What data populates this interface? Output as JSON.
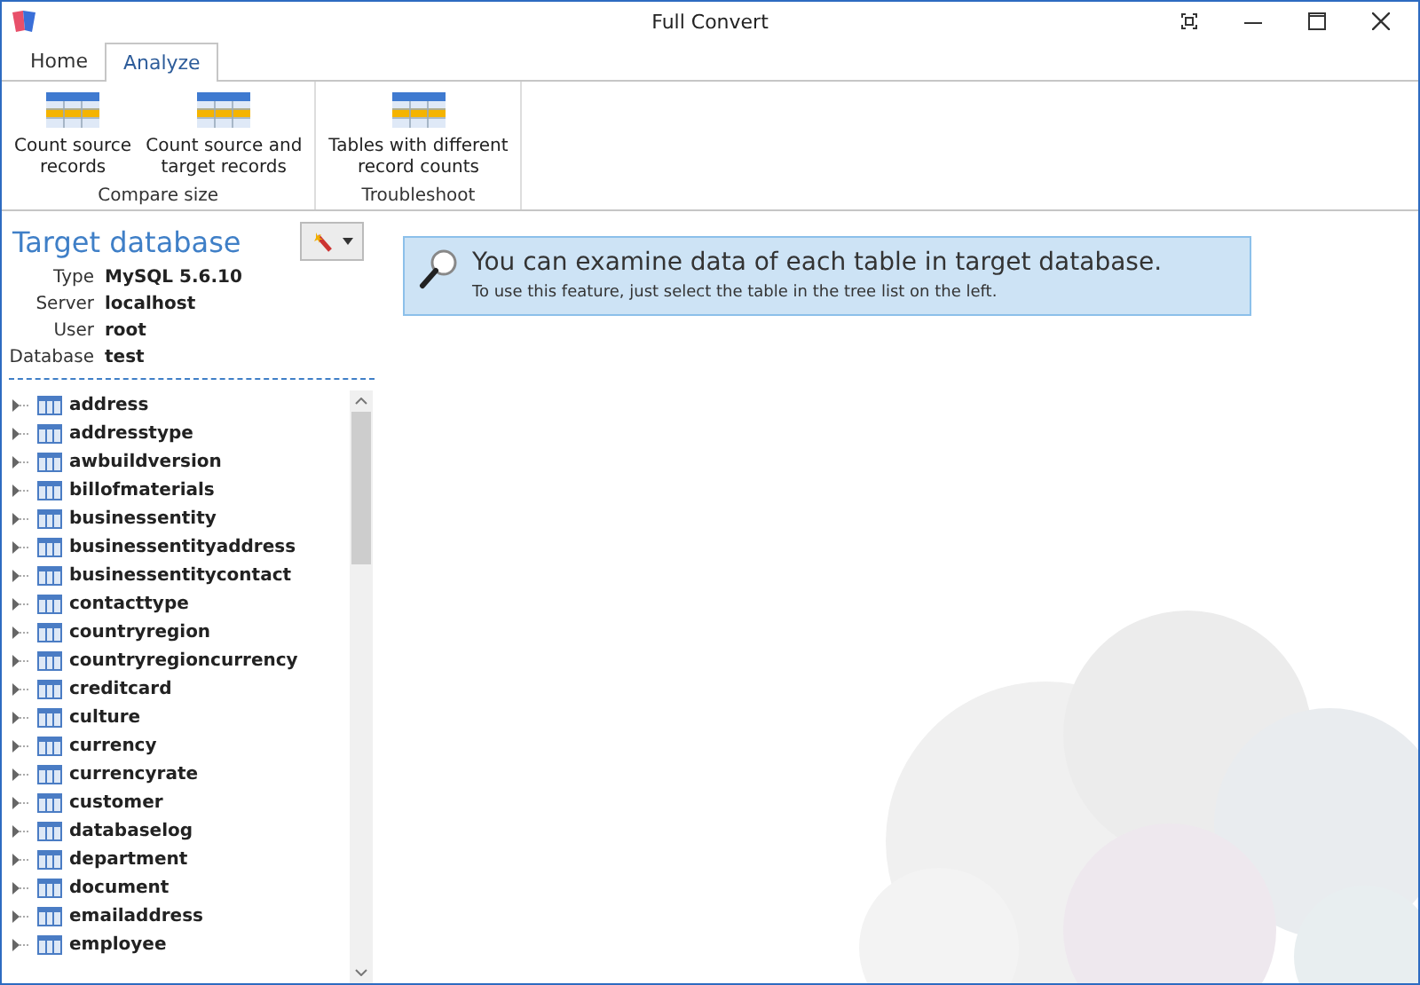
{
  "window": {
    "title": "Full Convert"
  },
  "tabs": [
    {
      "label": "Home",
      "selected": false
    },
    {
      "label": "Analyze",
      "selected": true
    }
  ],
  "ribbon": {
    "groups": [
      {
        "label": "Compare size",
        "buttons": [
          "Count source\nrecords",
          "Count source and\ntarget records"
        ]
      },
      {
        "label": "Troubleshoot",
        "buttons": [
          "Tables with different\nrecord counts"
        ]
      }
    ]
  },
  "panel": {
    "title": "Target database",
    "properties": [
      {
        "label": "Type",
        "value": "MySQL 5.6.10"
      },
      {
        "label": "Server",
        "value": "localhost"
      },
      {
        "label": "User",
        "value": "root"
      },
      {
        "label": "Database",
        "value": "test"
      }
    ],
    "tables": [
      "address",
      "addresstype",
      "awbuildversion",
      "billofmaterials",
      "businessentity",
      "businessentityaddress",
      "businessentitycontact",
      "contacttype",
      "countryregion",
      "countryregioncurrency",
      "creditcard",
      "culture",
      "currency",
      "currencyrate",
      "customer",
      "databaselog",
      "department",
      "document",
      "emailaddress",
      "employee"
    ]
  },
  "info": {
    "heading": "You can examine data of each table in target database.",
    "text": "To use this feature, just select the table in the tree list on the left."
  }
}
